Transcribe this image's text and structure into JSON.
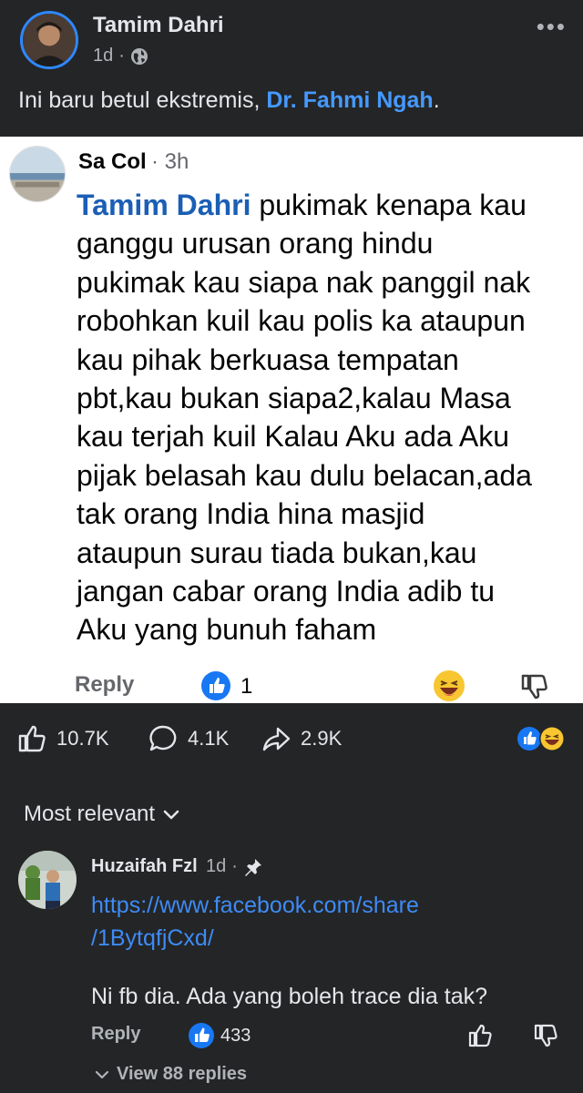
{
  "post": {
    "author": "Tamim Dahri",
    "time": "1d",
    "time_sep": " ·",
    "text_before": "Ini baru betul ekstremis, ",
    "mention": "Dr. Fahmi Ngah",
    "text_after": "."
  },
  "screenshot_comment": {
    "author": "Sa Col",
    "time": "· 3h",
    "mention": "Tamim Dahri",
    "lines": [
      "pukimak kenapa kau",
      "ganggu urusan orang hindu",
      "pukimak kau siapa nak panggil nak",
      "robohkan kuil kau polis ka ataupun",
      "kau pihak berkuasa tempatan",
      "pbt,kau bukan siapa2,kalau Masa",
      "kau terjah kuil Kalau Aku ada Aku",
      "pijak belasah kau dulu belacan,ada",
      "tak orang India hina masjid",
      "ataupun surau tiada bukan,kau",
      "jangan cabar orang India adib tu",
      "Aku yang bunuh faham"
    ],
    "reply_label": "Reply",
    "like_count": "1"
  },
  "reactions": {
    "likes": "10.7K",
    "comments": "4.1K",
    "shares": "2.9K"
  },
  "comments_section": {
    "sort_label": "Most relevant",
    "comment": {
      "author": "Huzaifah Fzl",
      "time": "1d",
      "time_sep": " ·",
      "link_line1": "https://www.facebook.com/share",
      "link_line2": "/1BytqfjCxd/",
      "text": "Ni fb dia. Ada yang boleh trace dia tak?",
      "reply_label": "Reply",
      "like_count": "433",
      "view_replies": "View 88 replies"
    }
  },
  "colors": {
    "dark_bg": "#242526",
    "accent_blue": "#2d88ff",
    "link_blue": "#3e8bf5"
  }
}
